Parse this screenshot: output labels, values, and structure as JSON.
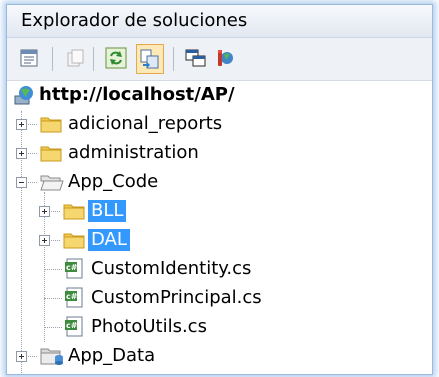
{
  "panel": {
    "title": "Explorador de soluciones"
  },
  "toolbar": {
    "buttons": [
      {
        "icon": "properties-icon"
      },
      {
        "icon": "show-all-files-icon"
      },
      {
        "icon": "refresh-icon"
      },
      {
        "icon": "nest-related-files-icon"
      },
      {
        "icon": "copy-website-icon"
      },
      {
        "icon": "asp-net-configuration-icon"
      }
    ]
  },
  "tree": {
    "root": {
      "label": "http://localhost/AP/",
      "icon": "website-globe-icon"
    },
    "items": [
      {
        "label": "adicional_reports",
        "icon": "folder-icon",
        "expander": "plus"
      },
      {
        "label": "administration",
        "icon": "folder-icon",
        "expander": "plus"
      },
      {
        "label": "App_Code",
        "icon": "folder-open-icon",
        "expander": "minus"
      },
      {
        "label": "BLL",
        "icon": "folder-icon",
        "expander": "plus",
        "selected": true
      },
      {
        "label": "DAL",
        "icon": "folder-icon",
        "expander": "plus",
        "selected": true
      },
      {
        "label": "CustomIdentity.cs",
        "icon": "csharp-file-icon"
      },
      {
        "label": "CustomPrincipal.cs",
        "icon": "csharp-file-icon"
      },
      {
        "label": "PhotoUtils.cs",
        "icon": "csharp-file-icon"
      },
      {
        "label": "App_Data",
        "icon": "app-data-folder-icon",
        "expander": "plus"
      }
    ]
  },
  "colors": {
    "selection": "#3399ff",
    "folder": "#f2c94c",
    "accent_border": "#e3a94a"
  }
}
